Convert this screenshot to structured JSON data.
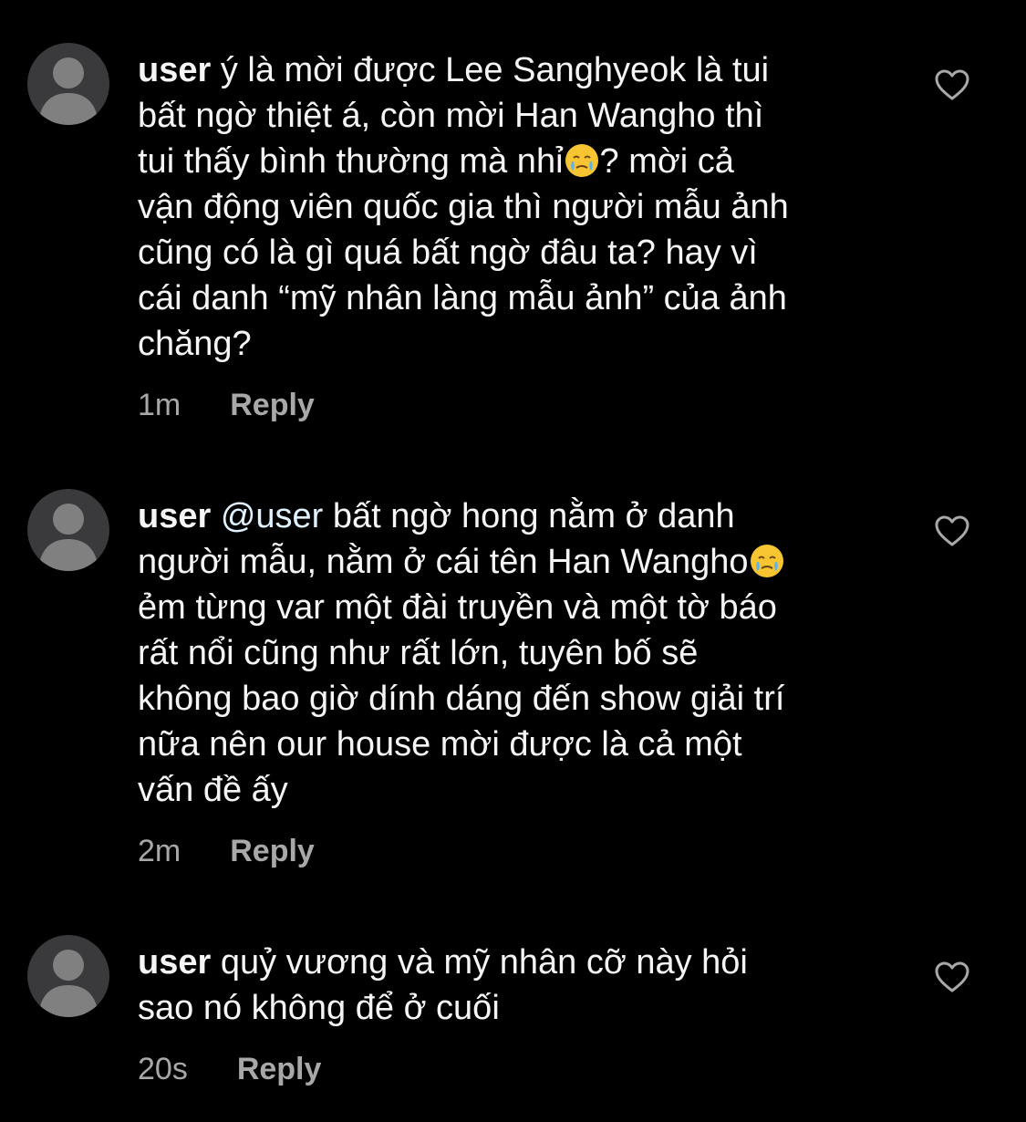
{
  "colors": {
    "background": "#000000",
    "text": "#f5f5f5",
    "secondary_text": "#a8a8a8",
    "avatar_background": "#3a3a3c",
    "avatar_silhouette": "#808080"
  },
  "icons": {
    "like": "heart-outline-icon",
    "avatar": "default-avatar-icon",
    "emoji": "face-holding-back-tears-emoji"
  },
  "comments": [
    {
      "username": "user",
      "lines": [
        " ý là mời được Lee Sanghyeok là tui",
        "bất ngờ thiệt á, còn mời Han Wangho thì",
        "tui thấy bình thường mà nhỉ",
        "? mời cả",
        "vận động viên quốc gia thì người mẫu ảnh",
        "cũng có là gì quá bất ngờ đâu ta? hay vì",
        "cái danh “mỹ nhân làng mẫu ảnh” của ảnh",
        "chăng?"
      ],
      "time": "1m",
      "reply_label": "Reply"
    },
    {
      "username": "user",
      "mention": "@user",
      "lines": [
        " bất ngờ hong nằm ở danh",
        "người mẫu, nằm ở cái tên Han Wangho",
        "ẻm từng var một đài truyền và một tờ báo",
        "rất nổi cũng như rất lớn, tuyên bố sẽ",
        "không bao giờ dính dáng đến show giải trí",
        "nữa nên our house mời được là cả một",
        "vấn đề ấy"
      ],
      "time": "2m",
      "reply_label": "Reply"
    },
    {
      "username": "user",
      "lines": [
        " quỷ vương và mỹ nhân cỡ này hỏi",
        "sao nó không để ở cuối"
      ],
      "time": "20s",
      "reply_label": "Reply"
    }
  ]
}
